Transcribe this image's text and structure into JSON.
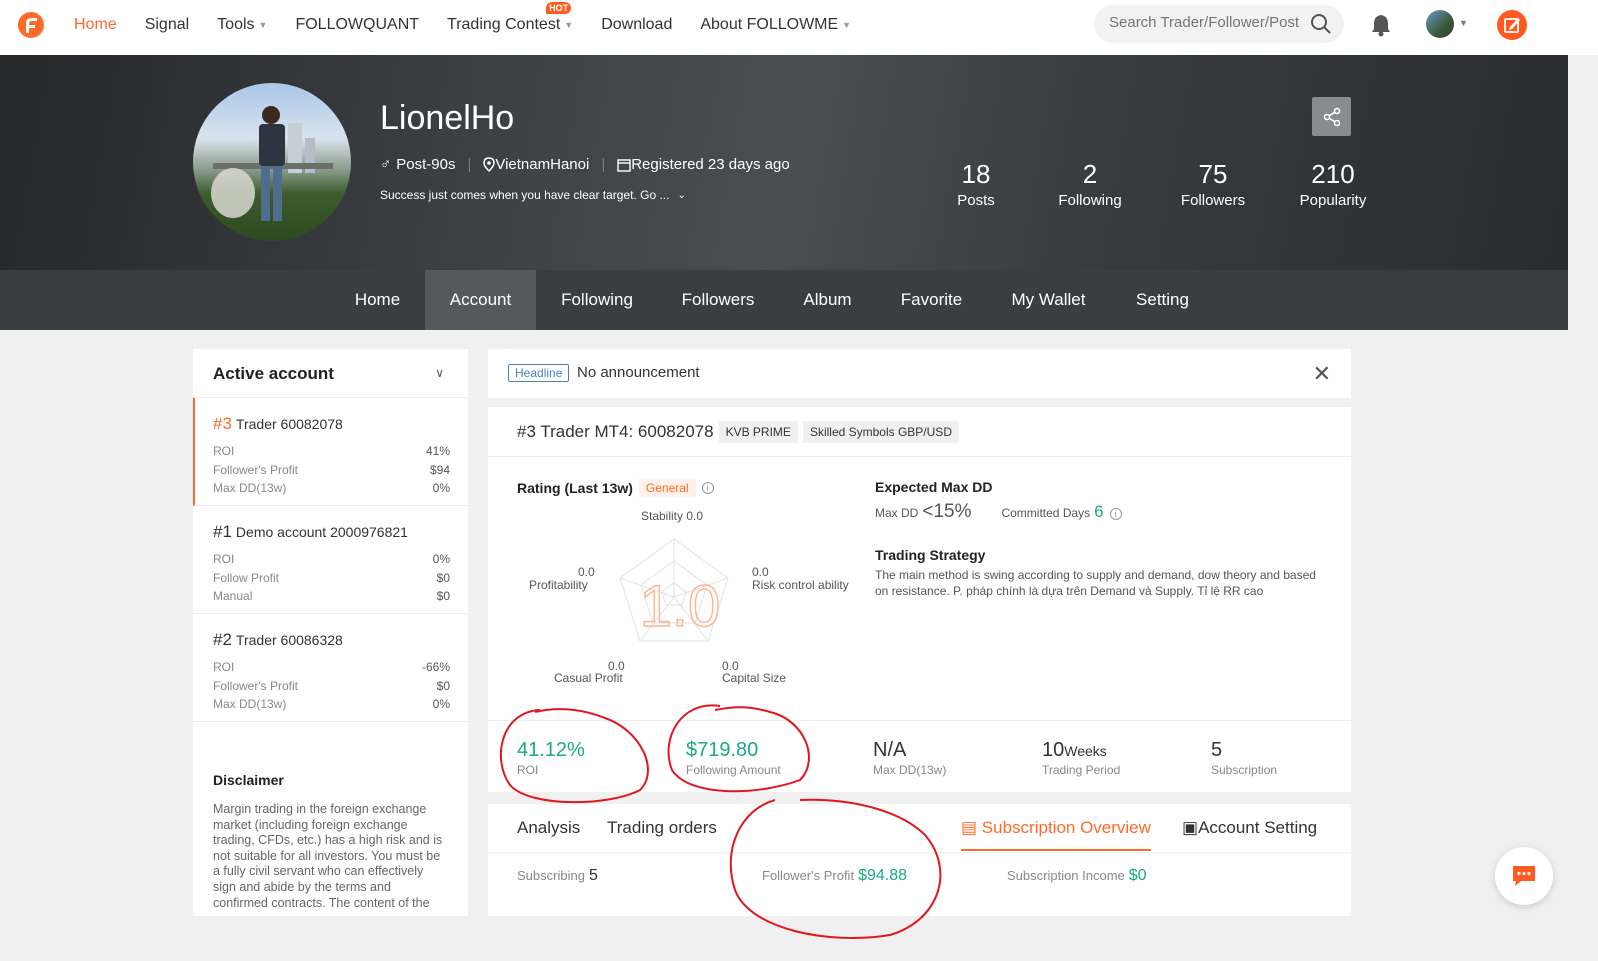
{
  "nav": {
    "items": [
      {
        "label": "Home",
        "caret": false
      },
      {
        "label": "Signal",
        "caret": false
      },
      {
        "label": "Tools",
        "caret": true
      },
      {
        "label": "FOLLOWQUANT",
        "caret": false
      },
      {
        "label": "Trading Contest",
        "caret": true
      },
      {
        "label": "Download",
        "caret": false
      },
      {
        "label": "About FOLLOWME",
        "caret": true
      }
    ],
    "hot_badge": "HOT",
    "search_placeholder": "Search Trader/Follower/Post"
  },
  "profile": {
    "name": "LionelHo",
    "age_group": "Post-90s",
    "location": "VietnamHanoi",
    "registered": "Registered 23 days ago",
    "bio": "Success just comes when you have clear target. Go ...",
    "stats": [
      {
        "value": "18",
        "label": "Posts"
      },
      {
        "value": "2",
        "label": "Following"
      },
      {
        "value": "75",
        "label": "Followers"
      },
      {
        "value": "210",
        "label": "Popularity"
      }
    ]
  },
  "tabs": [
    "Home",
    "Account",
    "Following",
    "Followers",
    "Album",
    "Favorite",
    "My Wallet",
    "Setting"
  ],
  "sidebar": {
    "title": "Active account",
    "accounts": [
      {
        "num": "#3",
        "name": "Trader 60082078",
        "rows": [
          [
            "ROI",
            "41%"
          ],
          [
            "Follower's Profit",
            "$94"
          ],
          [
            "Max DD(13w)",
            "0%"
          ]
        ]
      },
      {
        "num": "#1",
        "name": "Demo account 2000976821",
        "rows": [
          [
            "ROI",
            "0%"
          ],
          [
            "Follow Profit",
            "$0"
          ],
          [
            "Manual",
            "$0"
          ]
        ]
      },
      {
        "num": "#2",
        "name": "Trader 60086328",
        "rows": [
          [
            "ROI",
            "-66%"
          ],
          [
            "Follower's Profit",
            "$0"
          ],
          [
            "Max DD(13w)",
            "0%"
          ]
        ]
      }
    ],
    "disclaimer_title": "Disclaimer",
    "disclaimer_text": "Margin trading in the foreign exchange market (including foreign exchange trading, CFDs, etc.) has a high risk and is not suitable for all investors. You must be a fully civil servant who can effectively sign and abide by the terms and confirmed contracts. The content of the"
  },
  "announcement": {
    "tag": "Headline",
    "text": "No announcement"
  },
  "trader": {
    "title": "#3 Trader MT4: 60082078",
    "chips": [
      "KVB PRIME",
      "Skilled Symbols GBP/USD"
    ],
    "rating_title": "Rating (Last 13w)",
    "rating_badge": "General",
    "score": "1.0",
    "radar": [
      {
        "value": "0.0",
        "label": "Stability"
      },
      {
        "value": "0.0",
        "label": "Risk control ability"
      },
      {
        "value": "0.0",
        "label": "Capital Size"
      },
      {
        "value": "0.0",
        "label": "Casual Profit"
      },
      {
        "value": "0.0",
        "label": "Profitability"
      }
    ],
    "dd_title": "Expected Max DD",
    "dd_label": "Max DD",
    "dd_value": "<15%",
    "committed_label": "Committed Days",
    "committed_value": "6",
    "strategy_title": "Trading Strategy",
    "strategy_text": "The main method is swing according to supply and demand, dow theory and based on resistance. P. pháp chính là dựa trên Demand và Supply. Tỉ lệ RR cao",
    "metrics": [
      {
        "value": "41.12%",
        "label": "ROI"
      },
      {
        "value": "$719.80",
        "label": "Following Amount"
      },
      {
        "value": "N/A",
        "label": "Max DD(13w)"
      },
      {
        "value": "10",
        "unit": "Weeks",
        "label": "Trading Period"
      },
      {
        "value": "5",
        "label": "Subscription"
      }
    ]
  },
  "bottom": {
    "tabs": [
      "Analysis",
      "Trading orders",
      "Subscription Overview",
      "Account Setting"
    ],
    "subscribing_label": "Subscribing",
    "subscribing_value": "5",
    "profit_label": "Follower's Profit",
    "profit_value": "$94.88",
    "income_label": "Subscription Income",
    "income_value": "$0"
  },
  "colors": {
    "accent": "#ff6a2a",
    "green": "#1aaa83",
    "annotation": "#e0171c"
  }
}
